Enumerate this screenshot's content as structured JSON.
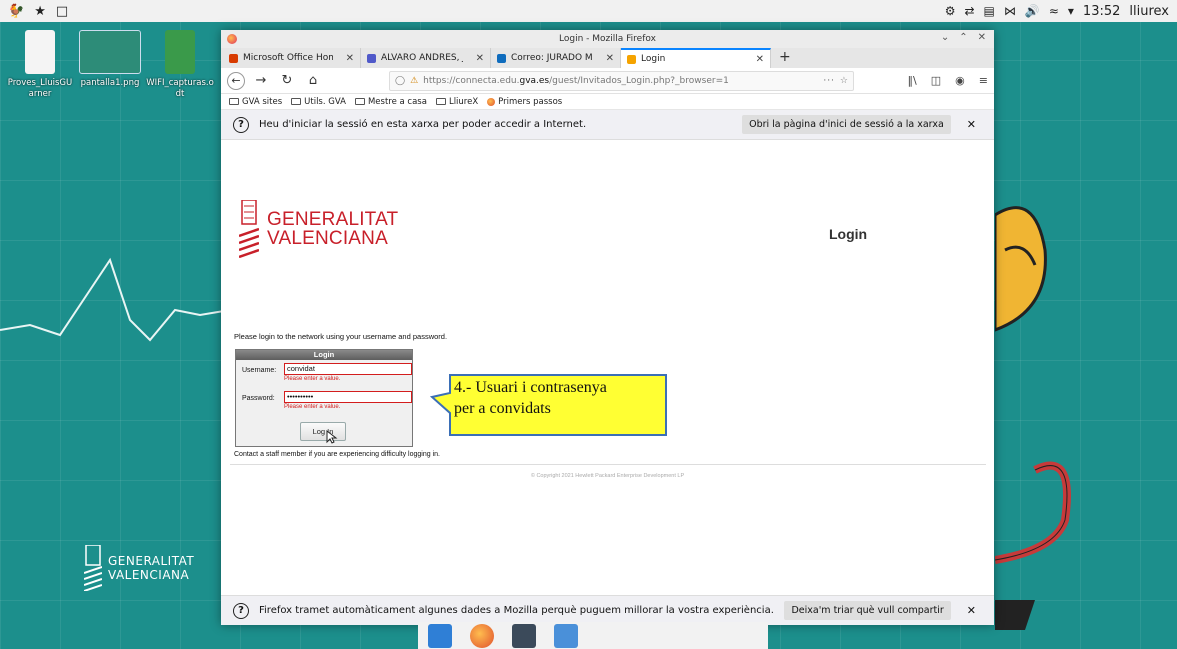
{
  "panel": {
    "clock": "13:52",
    "user": "lliurex"
  },
  "desktop": {
    "icons": [
      {
        "label": "Proves_LluisGU arner"
      },
      {
        "label": "pantalla1.png"
      },
      {
        "label": "WIFI_capturas.o dt"
      }
    ],
    "logo_line1": "GENERALITAT",
    "logo_line2": "VALENCIANA"
  },
  "firefox": {
    "window_title": "Login - Mozilla Firefox",
    "tabs": [
      {
        "title": "Microsoft Office Home",
        "color": "#d83b01",
        "active": false
      },
      {
        "title": "ÁLVARO ANDRÉS, JESÚS |",
        "color": "#5059c9",
        "active": false
      },
      {
        "title": "Correo: JURADO MEDINA",
        "color": "#0f6cbd",
        "active": false
      },
      {
        "title": "Login",
        "color": "#f5a300",
        "active": true
      }
    ],
    "new_tab": "+",
    "url_prefix": "https://connecta.edu.",
    "url_domain": "gva.es",
    "url_suffix": "/guest/Invitados_Login.php?_browser=1",
    "page_actions": "···",
    "bookmarks": [
      {
        "label": "GVA sites",
        "kind": "folder"
      },
      {
        "label": "Utils. GVA",
        "kind": "folder"
      },
      {
        "label": "Mestre a casa",
        "kind": "folder"
      },
      {
        "label": "LliureX",
        "kind": "folder"
      },
      {
        "label": "Primers passos",
        "kind": "firefox"
      }
    ],
    "notification_top": {
      "text": "Heu d'iniciar la sessió en esta xarxa per poder accedir a Internet.",
      "button": "Obri la pàgina d'inici de sessió a la xarxa"
    },
    "notification_bottom": {
      "text": "Firefox tramet automàticament algunes dades a Mozilla perquè puguem millorar la vostra experiència.",
      "button": "Deixa'm triar què vull compartir"
    }
  },
  "page": {
    "logo_line1": "GENERALITAT",
    "logo_line2": "VALENCIANA",
    "heading": "Login",
    "intro": "Please login to the network using your username and password.",
    "login_box_title": "Login",
    "username_label": "Username:",
    "username_value": "convidat",
    "username_error": "Please enter a value.",
    "password_label": "Password:",
    "password_value": "••••••••••",
    "password_error": "Please enter a value.",
    "login_button": "Log In",
    "contact": "Contact a staff member if you are experiencing difficulty logging in.",
    "copyright": "© Copyright 2021 Hewlett Packard Enterprise Development LP"
  },
  "callout": {
    "line1": "4.- Usuari i contrasenya",
    "line2": "per a convidats",
    "fill_color": "#ffff33"
  }
}
